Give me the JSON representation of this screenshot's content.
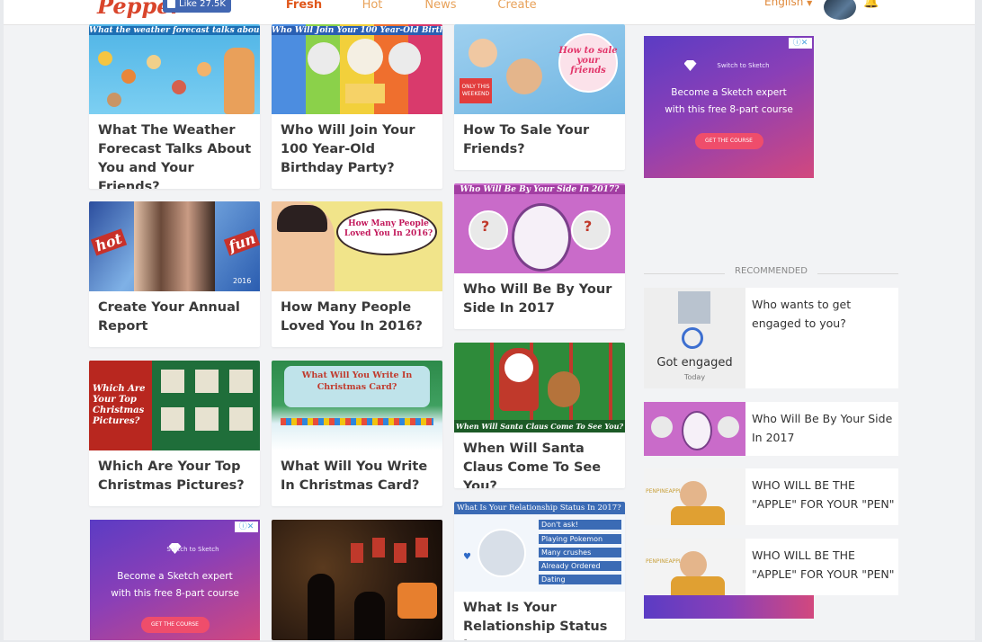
{
  "header": {
    "logo": "Pepper",
    "like_label": "Like 27.5K",
    "tabs": [
      "Fresh",
      "Hot",
      "News",
      "Create"
    ],
    "active_tab": "Fresh",
    "language": "English"
  },
  "cards": [
    {
      "title": "What The Weather Forecast Talks About You and Your Friends?",
      "caption": "What the weather forecast talks about you and your friends!"
    },
    {
      "title": "Who Will Join Your 100 Year-Old Birthday Party?",
      "caption": "Who Will Join Your 100 Year-Old Birthday Party!"
    },
    {
      "title": "How To Sale Your Friends?",
      "caption": "How to sale your friends",
      "sticker": "ONLY THIS WEEKEND"
    },
    {
      "title": "Create Your Annual Report",
      "caption": "2016",
      "left_word": "hot",
      "right_word": "fun"
    },
    {
      "title": "How Many People Loved You In 2016?",
      "caption": "How Many People Loved You In 2016?"
    },
    {
      "title": "Who Will Be By Your Side In 2017",
      "caption": "Who Will Be By Your Side In 2017?"
    },
    {
      "title": "Which Are Your Top Christmas Pictures?",
      "caption": "Which Are Your Top Christmas Pictures?"
    },
    {
      "title": "What Will You Write In Christmas Card?",
      "caption": "What Will You Write In Christmas Card?"
    },
    {
      "title": "When Will Santa Claus Come To See You?",
      "caption": "When Will Santa Claus Come To See You?"
    },
    {
      "title": "What Is Your Relationship Status In",
      "caption": "What Is Your Relationship Status In 2017?",
      "options": [
        "Don't ask!",
        "Playing Pokemon",
        "Many crushes",
        "Already Ordered",
        "Dating"
      ]
    }
  ],
  "ad": {
    "brand": "Switch to Sketch",
    "line1": "Become a Sketch expert",
    "line2": "with this free 8-part course",
    "button": "GET THE COURSE"
  },
  "recommended": {
    "heading": "RECOMMENDED",
    "items": [
      {
        "title": "Who wants to get engaged to you?",
        "thumb_label": "Got engaged",
        "thumb_sub": "Today"
      },
      {
        "title": "Who Will Be By Your Side In 2017"
      },
      {
        "title": "WHO WILL BE THE \"APPLE\" FOR YOUR \"PEN\"",
        "thumb_label": "PENPINEAPPLE"
      },
      {
        "title": "WHO WILL BE THE \"APPLE\" FOR YOUR \"PEN\"",
        "thumb_label": "PENPINEAPPLE"
      }
    ]
  },
  "colors": {
    "accent": "#e0571b",
    "brand": "#d9452b",
    "facebook": "#4267b2"
  }
}
